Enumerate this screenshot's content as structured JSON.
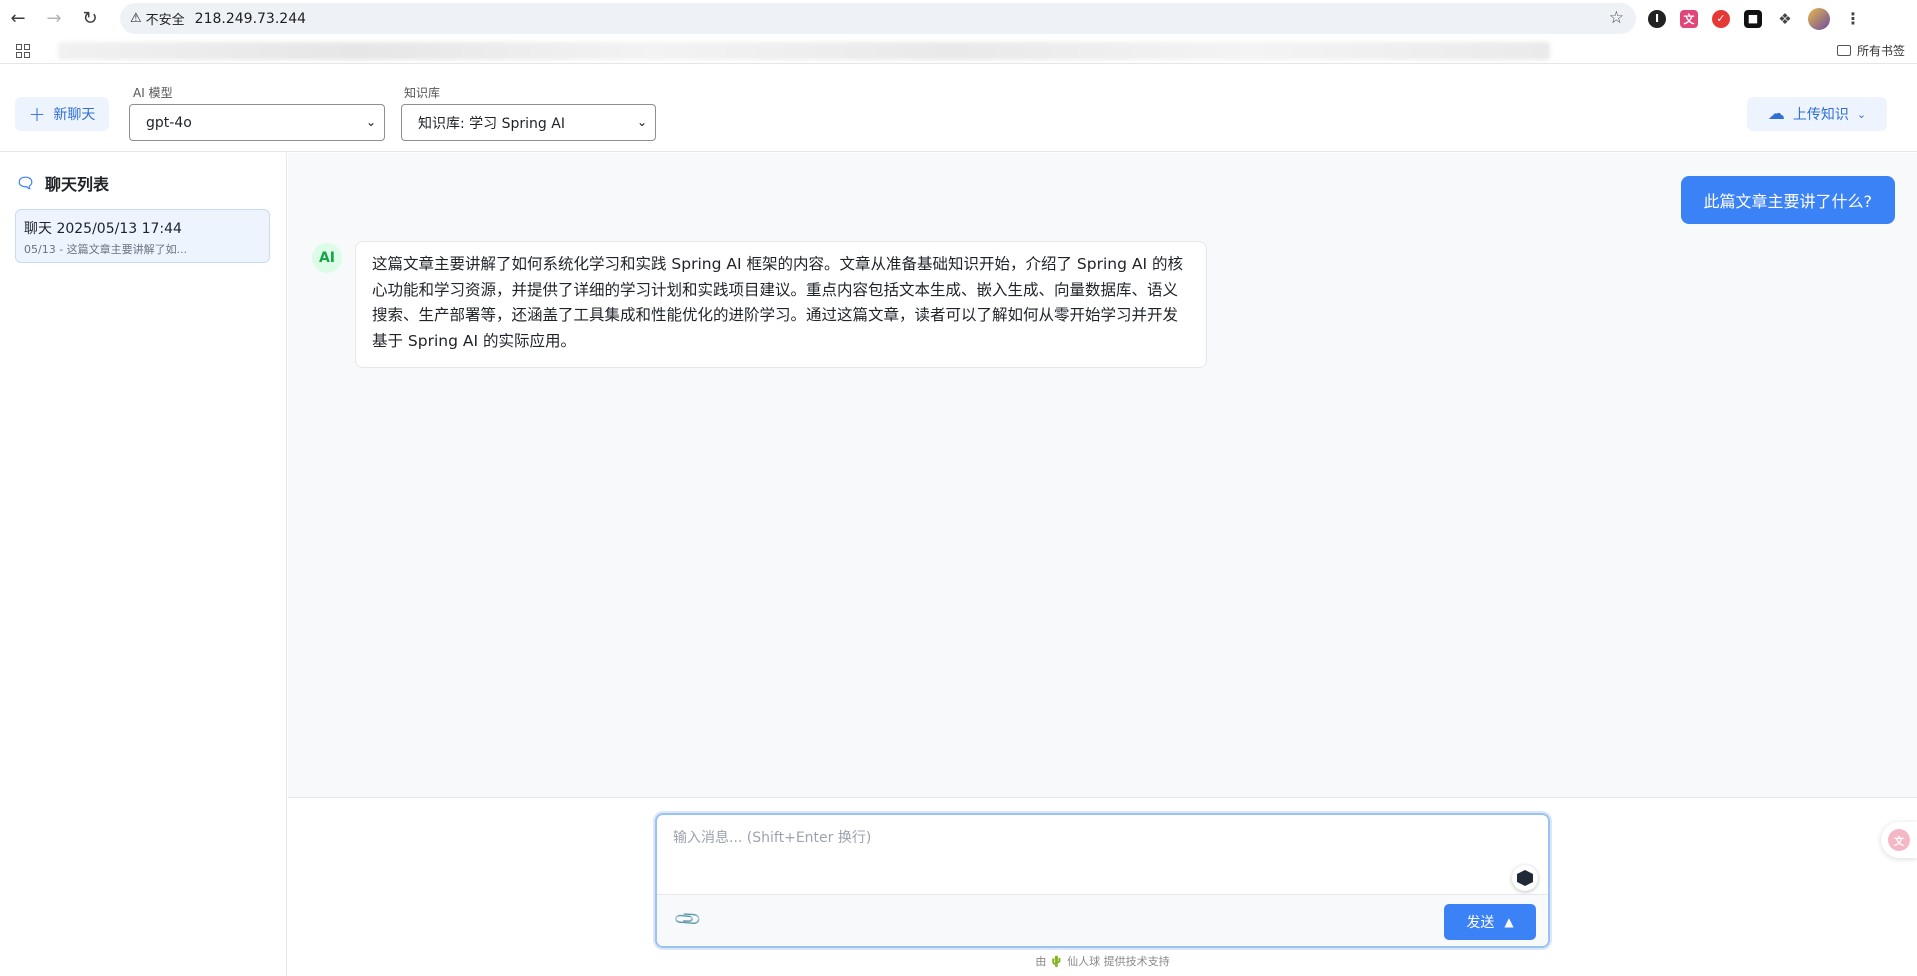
{
  "browser": {
    "security_label": "不安全",
    "url": "218.249.73.244",
    "bookmarks_all_label": "所有书签",
    "icons": [
      "back-icon",
      "forward-icon",
      "reload-icon",
      "warning-icon",
      "star-icon",
      "extension-icon",
      "profile-avatar",
      "more-icon"
    ]
  },
  "toolbar": {
    "new_chat_label": "新聊天",
    "model_label": "AI 模型",
    "model_value": "gpt-4o",
    "kb_label": "知识库",
    "kb_value": "知识库: 学习 Spring AI",
    "upload_label": "上传知识"
  },
  "sidebar": {
    "title": "聊天列表",
    "items": [
      {
        "title": "聊天 2025/05/13 17:44",
        "subtitle": "05/13 - 这篇文章主要讲解了如..."
      }
    ]
  },
  "chat": {
    "user_message": "此篇文章主要讲了什么?",
    "ai_avatar": "AI",
    "ai_message": "这篇文章主要讲解了如何系统化学习和实践 Spring AI 框架的内容。文章从准备基础知识开始，介绍了 Spring AI 的核心功能和学习资源，并提供了详细的学习计划和实践项目建议。重点内容包括文本生成、嵌入生成、向量数据库、语义搜索、生产部署等，还涵盖了工具集成和性能优化的进阶学习。通过这篇文章，读者可以了解如何从零开始学习并开发基于 Spring AI 的实际应用。"
  },
  "composer": {
    "placeholder": "输入消息... (Shift+Enter 换行)",
    "send_label": "发送",
    "powered_by": "由 🌵 仙人球 提供技术支持"
  },
  "colors": {
    "accent": "#3b82f6",
    "accent_light": "#eef4fd",
    "ai_avatar_bg": "#dcfce7",
    "ai_avatar_text": "#16a34a"
  }
}
